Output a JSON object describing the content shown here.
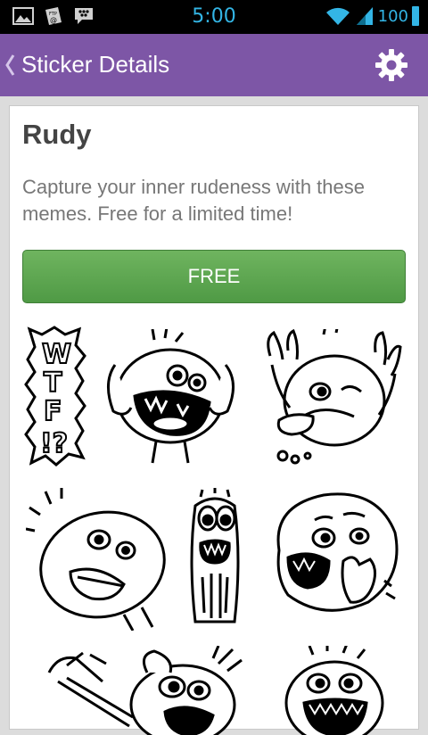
{
  "status_bar": {
    "time": "5:00",
    "battery": "100",
    "icons": [
      "gallery-icon",
      "ftp-icon",
      "blackberry-messenger-icon",
      "wifi-icon",
      "signal-icon",
      "battery-icon"
    ]
  },
  "action_bar": {
    "title": "Sticker Details",
    "back_icon": "chevron-left-icon",
    "settings_icon": "gear-icon",
    "color": "#7d56a6"
  },
  "sticker_pack": {
    "name": "Rudy",
    "description": "Capture your inner rudeness with these memes. Free for a limited time!",
    "button_label": "FREE",
    "button_color": "#5aa64e",
    "stickers": [
      {
        "name": "WTF!?",
        "kind": "text-sticker"
      },
      {
        "name": "shouting-face",
        "kind": "face"
      },
      {
        "name": "hands-up-tongue-face",
        "kind": "face"
      },
      {
        "name": "scared-round-face",
        "kind": "face"
      },
      {
        "name": "thin-screaming-face",
        "kind": "face"
      },
      {
        "name": "nose-picking-face",
        "kind": "face"
      },
      {
        "name": "running-face",
        "kind": "face"
      },
      {
        "name": "yelling-face",
        "kind": "face"
      },
      {
        "name": "laughing-face",
        "kind": "face"
      }
    ]
  }
}
